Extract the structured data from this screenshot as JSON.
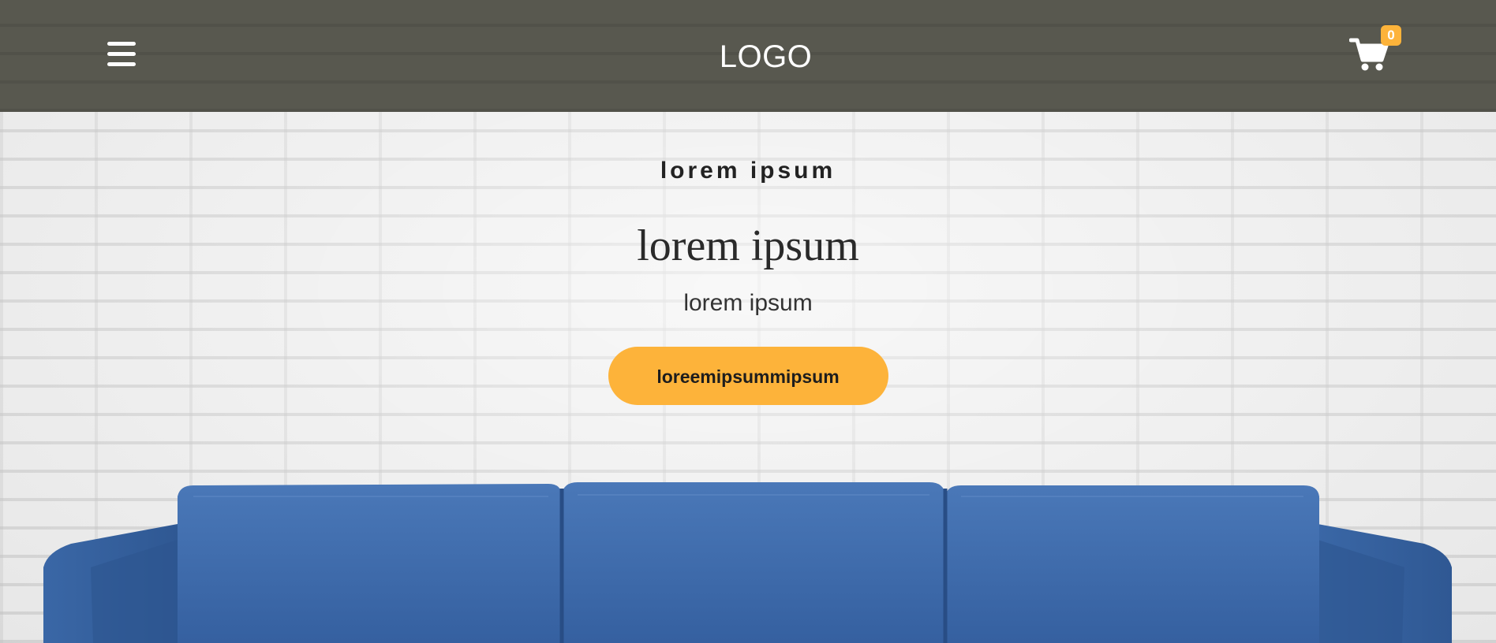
{
  "header": {
    "menu_icon": "hamburger-menu-icon",
    "logo_text": "LOGO",
    "cart_icon": "shopping-cart-icon",
    "cart_count": "0"
  },
  "hero": {
    "kicker": "lorem ipsum",
    "headline": "lorem ipsum",
    "subhead": "lorem ipsum",
    "cta_label": "loreemipsummipsum"
  },
  "colors": {
    "header_bg": "#58584f",
    "accent": "#fdb33a",
    "sofa": "#3d6aa8"
  }
}
